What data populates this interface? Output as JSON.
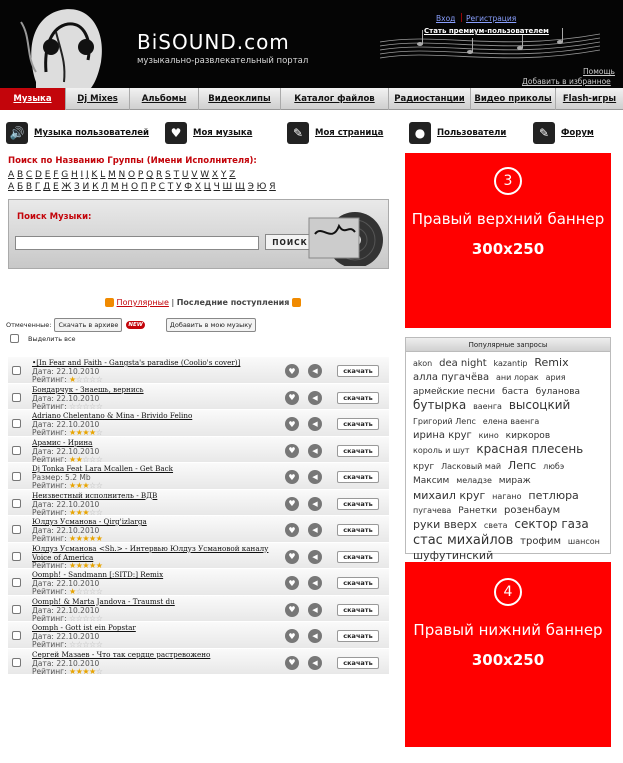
{
  "header": {
    "logo_text": "BiSOUND.com",
    "slogan": "музыкально-развлекательный портал",
    "login": "Вход",
    "register": "Регистрация",
    "premium": "Стать премиум-пользователем",
    "help": "Помощь",
    "favorite": "Добавить в избранное"
  },
  "nav": {
    "items": [
      "Музыка",
      "Dj Mixes",
      "Альбомы",
      "Видеоклипы",
      "Каталог файлов",
      "Радиостанции",
      "Видео приколы",
      "Flash-игры"
    ]
  },
  "subnav": {
    "items": [
      "Музыка пользователей",
      "Моя музыка",
      "Моя страница",
      "Пользователи",
      "Форум"
    ]
  },
  "alphabet": {
    "title": "Поиск по Названию Группы (Имени Исполнителя):",
    "latin": "A B C D E F G H I J K L M N O P Q R S T U V W X Y Z",
    "cyrillic": "А Б В Г Д Е Ж З И К Л М Н О П Р С Т У Ф Х Ц Ч Ш Щ Э Ю Я"
  },
  "search": {
    "title": "Поиск Музыки:",
    "button": "ПОИСК",
    "value": ""
  },
  "tabs": {
    "popular": "Популярные",
    "sep": "|",
    "latest": "Последние поступления"
  },
  "controls": {
    "marked": "Отмеченные:",
    "download_archive": "Скачать в архиве",
    "new_badge": "NEW",
    "add_to_my": "Добавить в мою музыку",
    "select_all": "Выделить все"
  },
  "track_labels": {
    "date": "Дата:",
    "rating": "Рейтинг:",
    "size": "Размер:",
    "download": "скачать"
  },
  "tracks": [
    {
      "title": "•[In Fear and Faith - Gangsta's paradise (Coolio's cover)]",
      "date": "22.10.2010",
      "rating": 1
    },
    {
      "title": "Бондарчук - Знаешь, вернись",
      "date": "22.10.2010",
      "rating": 0
    },
    {
      "title": "Adriano Chelentano & Mina - Brivido Felino",
      "date": "22.10.2010",
      "rating": 4
    },
    {
      "title": "Арамис - Ирина",
      "date": "22.10.2010",
      "rating": 2
    },
    {
      "title": "Dj Tonka Feat Lara Mcallen - Get Back",
      "size": "5.2 Mb",
      "rating": 3
    },
    {
      "title": "Неизвестный исполнитель - ВДВ",
      "date": "22.10.2010",
      "rating": 3
    },
    {
      "title": "Юлдуз Усманова - Qirg'izlarga",
      "date": "22.10.2010",
      "rating": 5
    },
    {
      "title": "Юлдуз Усманова <Sh.> - Интервью Юлдуз Усмановой каналу Voice of America",
      "date": "",
      "rating": 5,
      "two_line": true
    },
    {
      "title": "Oomph! - Sandmann [:SITD:] Remix",
      "date": "22.10.2010",
      "rating": 1
    },
    {
      "title": "Oomph! & Marta Jandova - Traumst du",
      "date": "22.10.2010",
      "rating": 0
    },
    {
      "title": "Oomph - Gott ist ein Popstar",
      "date": "22.10.2010",
      "rating": 0
    },
    {
      "title": "Сергей Мазаев - Что так сердце растревожено",
      "date": "22.10.2010",
      "rating": 4
    }
  ],
  "banners": {
    "top": {
      "number": "3",
      "text": "Правый верхний баннер",
      "size": "300x250",
      "color": "#ff0000"
    },
    "bottom": {
      "number": "4",
      "text": "Правый нижний баннер",
      "size": "300x250",
      "color": "#ff0000"
    }
  },
  "popular_queries": {
    "title": "Популярные запросы",
    "tags": [
      {
        "t": "akon",
        "s": 8
      },
      {
        "t": "dea night",
        "s": 10
      },
      {
        "t": "kazantip",
        "s": 8
      },
      {
        "t": "Remix",
        "s": 11
      },
      {
        "t": "алла пугачёва",
        "s": 10
      },
      {
        "t": "ани лорак",
        "s": 8
      },
      {
        "t": "ария",
        "s": 8
      },
      {
        "t": "армейские песни",
        "s": 9
      },
      {
        "t": "баста",
        "s": 9
      },
      {
        "t": "буланова",
        "s": 9
      },
      {
        "t": "бутырка",
        "s": 12
      },
      {
        "t": "ваенга",
        "s": 8
      },
      {
        "t": "высоцкий",
        "s": 12
      },
      {
        "t": "Григорий Лепс",
        "s": 8
      },
      {
        "t": "елена ваенга",
        "s": 8
      },
      {
        "t": "ирина круг",
        "s": 10
      },
      {
        "t": "кино",
        "s": 8
      },
      {
        "t": "киркоров",
        "s": 9
      },
      {
        "t": "король и шут",
        "s": 8
      },
      {
        "t": "красная плесень",
        "s": 12
      },
      {
        "t": "круг",
        "s": 9
      },
      {
        "t": "Ласковый май",
        "s": 8
      },
      {
        "t": "Лепс",
        "s": 11
      },
      {
        "t": "любэ",
        "s": 8
      },
      {
        "t": "Максим",
        "s": 9
      },
      {
        "t": "меладзе",
        "s": 8
      },
      {
        "t": "мираж",
        "s": 9
      },
      {
        "t": "михаил круг",
        "s": 11
      },
      {
        "t": "нагано",
        "s": 8
      },
      {
        "t": "петлюра",
        "s": 11
      },
      {
        "t": "пугачева",
        "s": 8
      },
      {
        "t": "Ранетки",
        "s": 9
      },
      {
        "t": "розенбаум",
        "s": 10
      },
      {
        "t": "руки вверх",
        "s": 11
      },
      {
        "t": "света",
        "s": 8
      },
      {
        "t": "сектор газа",
        "s": 12
      },
      {
        "t": "стас михайлов",
        "s": 13
      },
      {
        "t": "трофим",
        "s": 10
      },
      {
        "t": "шансон",
        "s": 8
      },
      {
        "t": "шуфутинский",
        "s": 11
      }
    ]
  }
}
